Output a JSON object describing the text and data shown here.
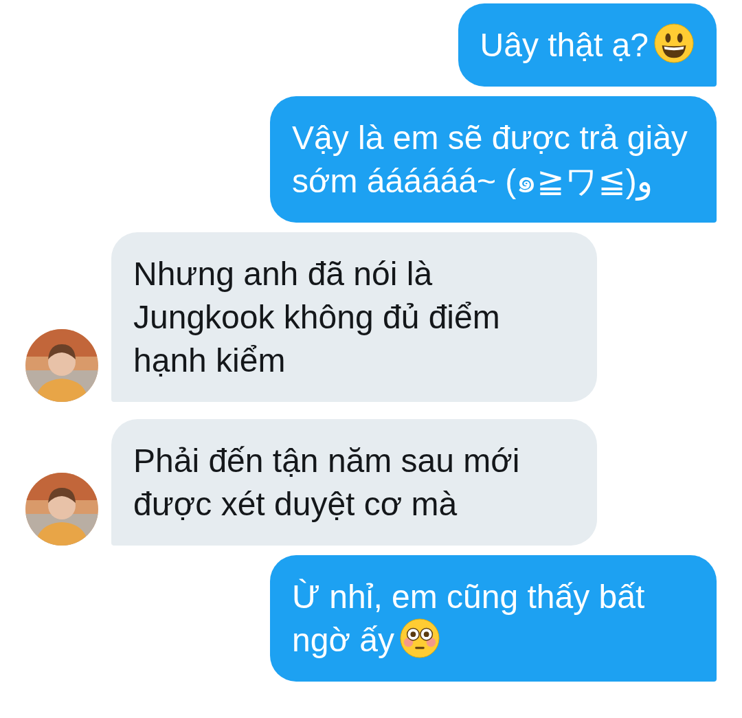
{
  "messages": [
    {
      "kind": "sent",
      "text": "Uây thật ạ?"
    },
    {
      "kind": "sent",
      "text": "Vậy là em sẽ được trả giày sớm áááááá~ (๑≧ワ≦)و"
    },
    {
      "kind": "received",
      "text": "Nhưng anh đã nói là Jungkook không đủ điểm hạnh kiểm"
    },
    {
      "kind": "received",
      "text": "Phải đến tận năm sau mới được xét duyệt cơ mà"
    },
    {
      "kind": "sent",
      "text": "Ừ nhỉ, em cũng thấy bất ngờ ấy"
    }
  ]
}
